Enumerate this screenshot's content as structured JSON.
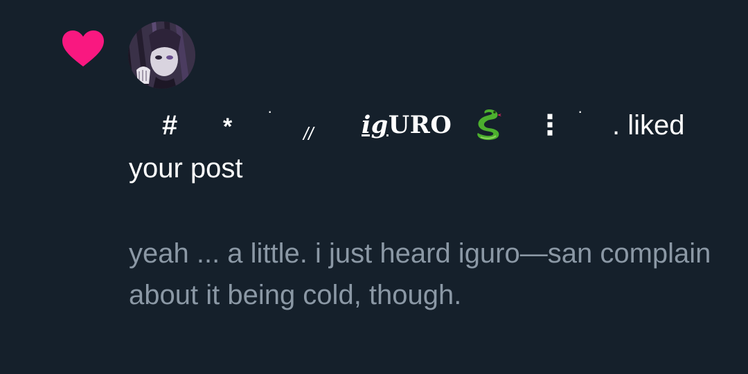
{
  "notification": {
    "type_icon": "heart-icon",
    "heart_color": "#f91880",
    "avatar": "user-avatar",
    "user_display_name": {
      "hash": "#",
      "star": "*",
      "dot_a": "·",
      "slashes": "//",
      "name_lead": "ig",
      "name_rest": "URO",
      "emoji": "snake-emoji",
      "colon": "⋮",
      "dot_b": "·"
    },
    "action_suffix": ". liked",
    "action_line2": "your post",
    "post_snippet": "yeah ... a little. i just heard iguro—san complain about it being cold, though."
  },
  "colors": {
    "background": "#15202b",
    "primary_text": "#ffffff",
    "secondary_text": "#8b98a5"
  }
}
